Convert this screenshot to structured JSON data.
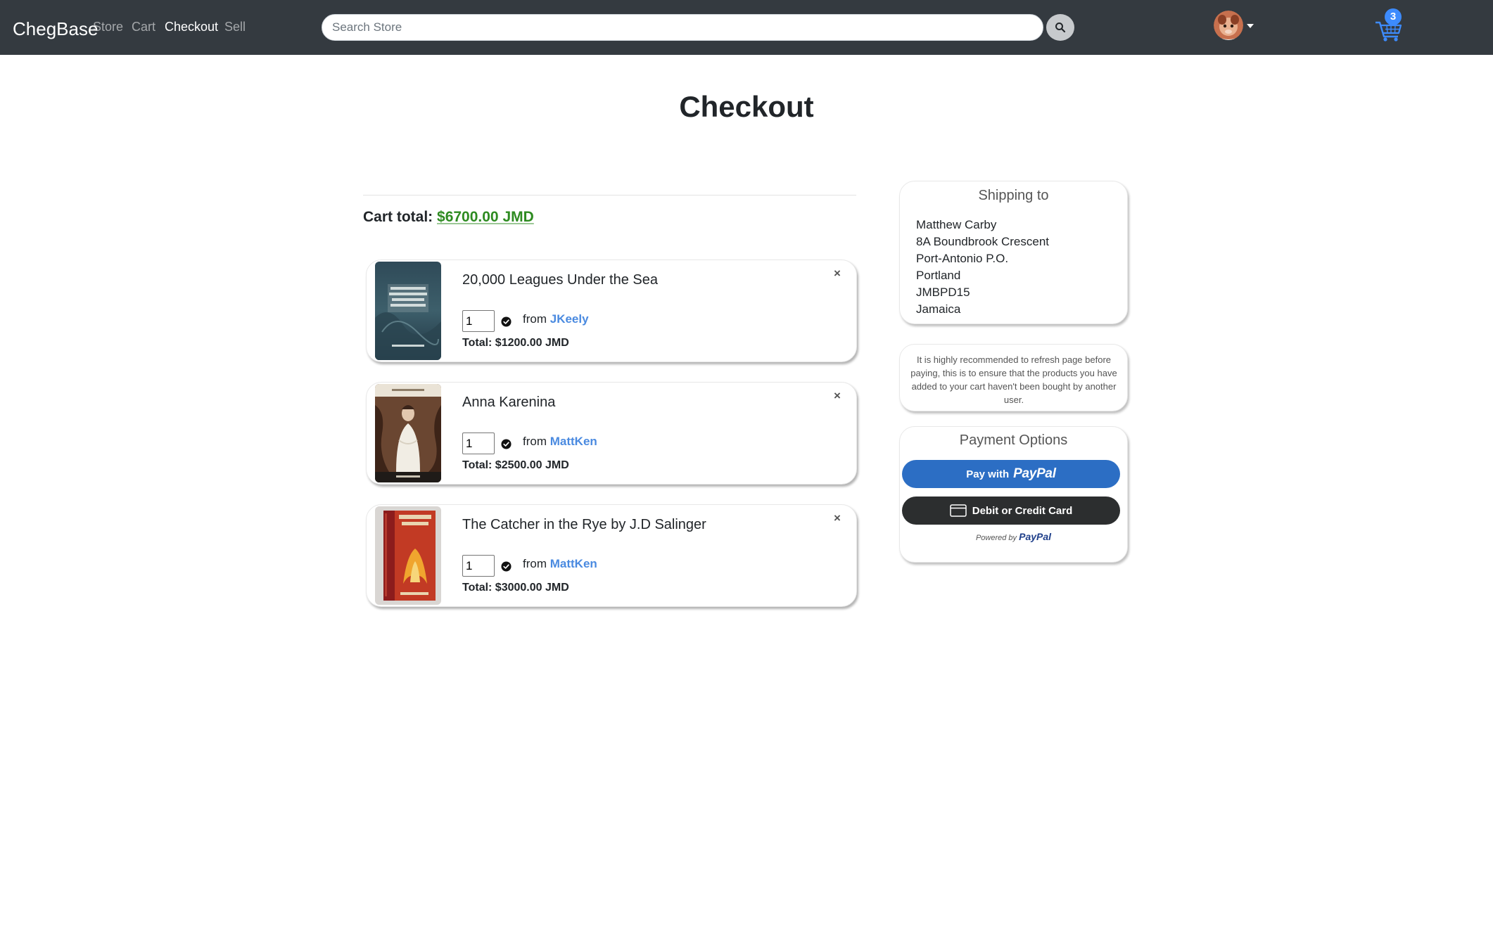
{
  "navbar": {
    "brand": "ChegBase",
    "links": [
      "Store",
      "Cart",
      "Checkout",
      "Sell"
    ],
    "active_link": "Checkout",
    "search_placeholder": "Search Store",
    "cart_count": "3",
    "icons": [
      "search-icon",
      "avatar",
      "caret-down-icon",
      "shopping-cart-icon"
    ],
    "colors": {
      "navbar_bg": "#343a40",
      "cart_icon": "#3d8bfd"
    }
  },
  "page": {
    "title": "Checkout",
    "cart_total_label": "Cart total:",
    "cart_total_value": "$6700.00 JMD",
    "colors": {
      "total_value": "#2e8b21",
      "seller_link": "#4a8ae0"
    }
  },
  "items": [
    {
      "title": "20,000 Leagues Under the Sea",
      "quantity": "1",
      "from_label": "from",
      "seller": "JKeely",
      "total": "Total: $1200.00 JMD",
      "remove": "×"
    },
    {
      "title": "Anna Karenina",
      "quantity": "1",
      "from_label": "from",
      "seller": "MattKen",
      "total": "Total: $2500.00 JMD",
      "remove": "×"
    },
    {
      "title": "The Catcher in the Rye by J.D Salinger",
      "quantity": "1",
      "from_label": "from",
      "seller": "MattKen",
      "total": "Total: $3000.00 JMD",
      "remove": "×"
    }
  ],
  "shipping": {
    "heading": "Shipping to",
    "lines": [
      "Matthew Carby",
      "8A Boundbrook Crescent",
      "Port-Antonio P.O.",
      "Portland",
      "JMBPD15",
      "Jamaica"
    ]
  },
  "notice": {
    "text": "It is highly recommended to refresh page before paying, this is to ensure that the products you have added to your cart haven't been bought by another user."
  },
  "payment": {
    "heading": "Payment Options",
    "paypal_prefix": "Pay with",
    "paypal_brand": "PayPal",
    "card_label": "Debit or Credit Card",
    "powered_prefix": "Powered by",
    "powered_brand": "PayPal",
    "colors": {
      "paypal_button": "#2c6ec4",
      "card_button": "#2c2e2f"
    }
  }
}
